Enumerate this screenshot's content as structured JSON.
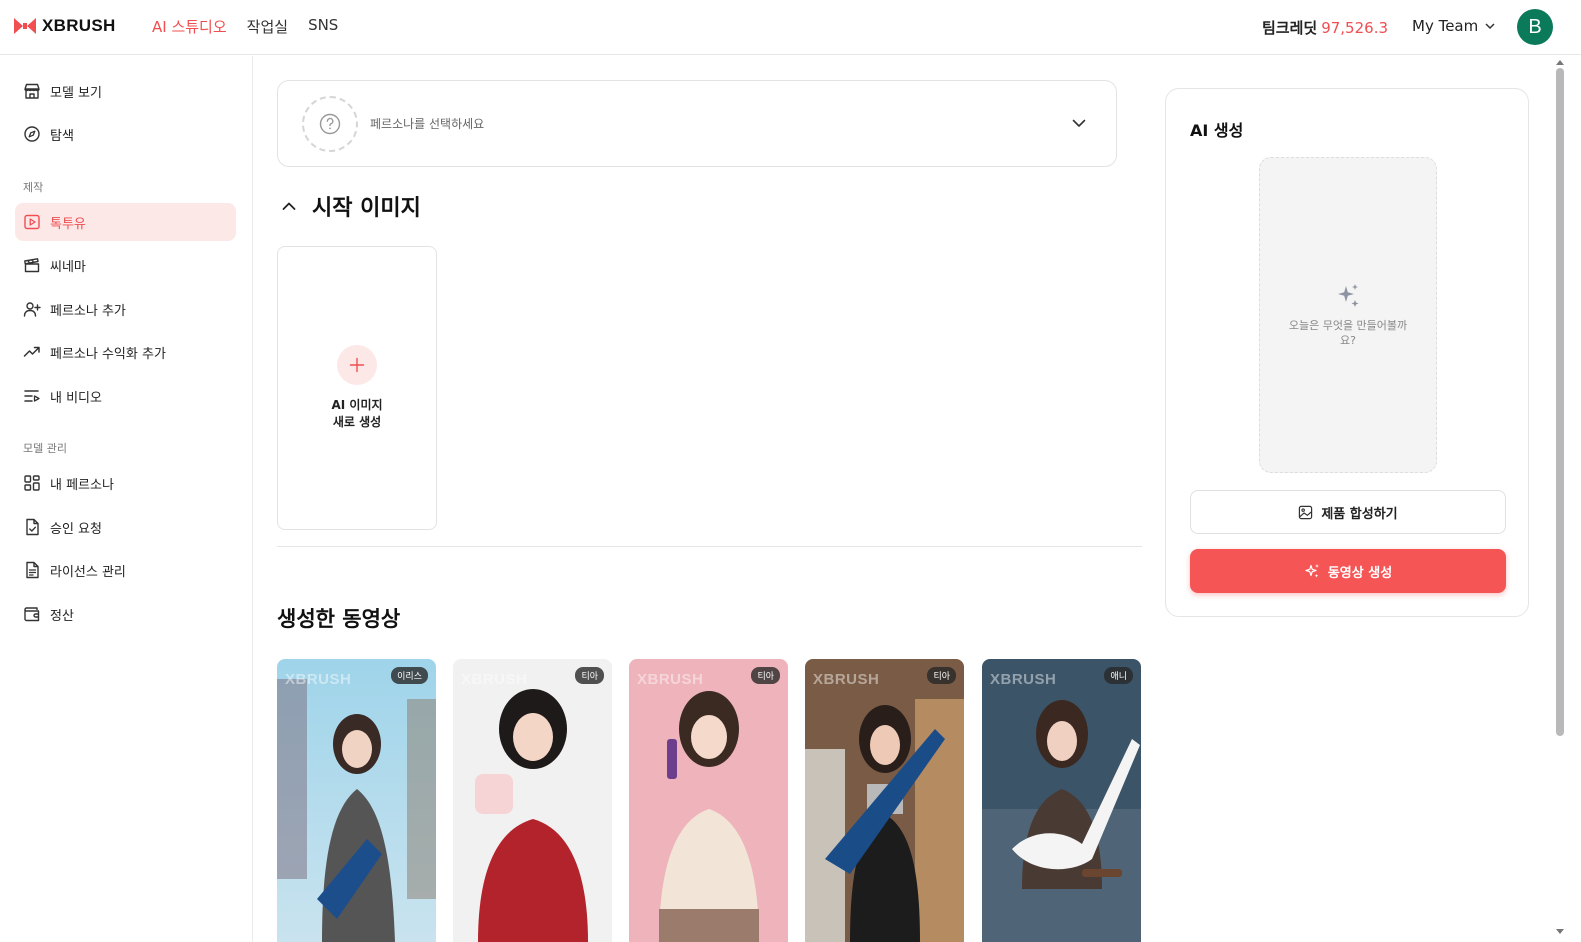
{
  "brand": {
    "name": "XBRUSH",
    "accent": "#f04e51"
  },
  "topnav": [
    {
      "label": "AI 스튜디오",
      "active": true
    },
    {
      "label": "작업실",
      "active": false
    },
    {
      "label": "SNS",
      "active": false
    }
  ],
  "header": {
    "credits_label": "팀크레딧",
    "credits_value": "97,526.3",
    "team_label": "My Team",
    "avatar_initial": "B"
  },
  "sidebar": {
    "items_top": [
      {
        "label": "모델 보기",
        "icon": "store-icon"
      },
      {
        "label": "탐색",
        "icon": "compass-icon"
      }
    ],
    "section_create": "제작",
    "items_create": [
      {
        "label": "톡투유",
        "icon": "play-square-icon",
        "active": true
      },
      {
        "label": "씨네마",
        "icon": "clapperboard-icon"
      },
      {
        "label": "페르소나 추가",
        "icon": "user-plus-icon"
      },
      {
        "label": "페르소나 수익화 추가",
        "icon": "trending-up-icon"
      },
      {
        "label": "내 비디오",
        "icon": "list-video-icon"
      }
    ],
    "section_manage": "모델 관리",
    "items_manage": [
      {
        "label": "내 페르소나",
        "icon": "grid-icon"
      },
      {
        "label": "승인 요청",
        "icon": "file-check-icon"
      },
      {
        "label": "라이선스 관리",
        "icon": "file-text-icon"
      },
      {
        "label": "정산",
        "icon": "wallet-icon"
      }
    ]
  },
  "persona_select": {
    "placeholder": "페르소나를 선택하세요"
  },
  "start_image": {
    "title": "시작 이미지",
    "new_card_line1": "AI 이미지",
    "new_card_line2": "새로 생성"
  },
  "videos": {
    "title": "생성한 동영상",
    "watermark": "XBRUSH",
    "items": [
      {
        "tag": "이리스"
      },
      {
        "tag": "티아"
      },
      {
        "tag": "티아"
      },
      {
        "tag": "티아"
      },
      {
        "tag": "애니"
      }
    ]
  },
  "generate_panel": {
    "title": "AI 생성",
    "preview_text": "오늘은 무엇을 만들어볼까요?",
    "compose_button": "제품 합성하기",
    "generate_button": "동영상 생성"
  }
}
